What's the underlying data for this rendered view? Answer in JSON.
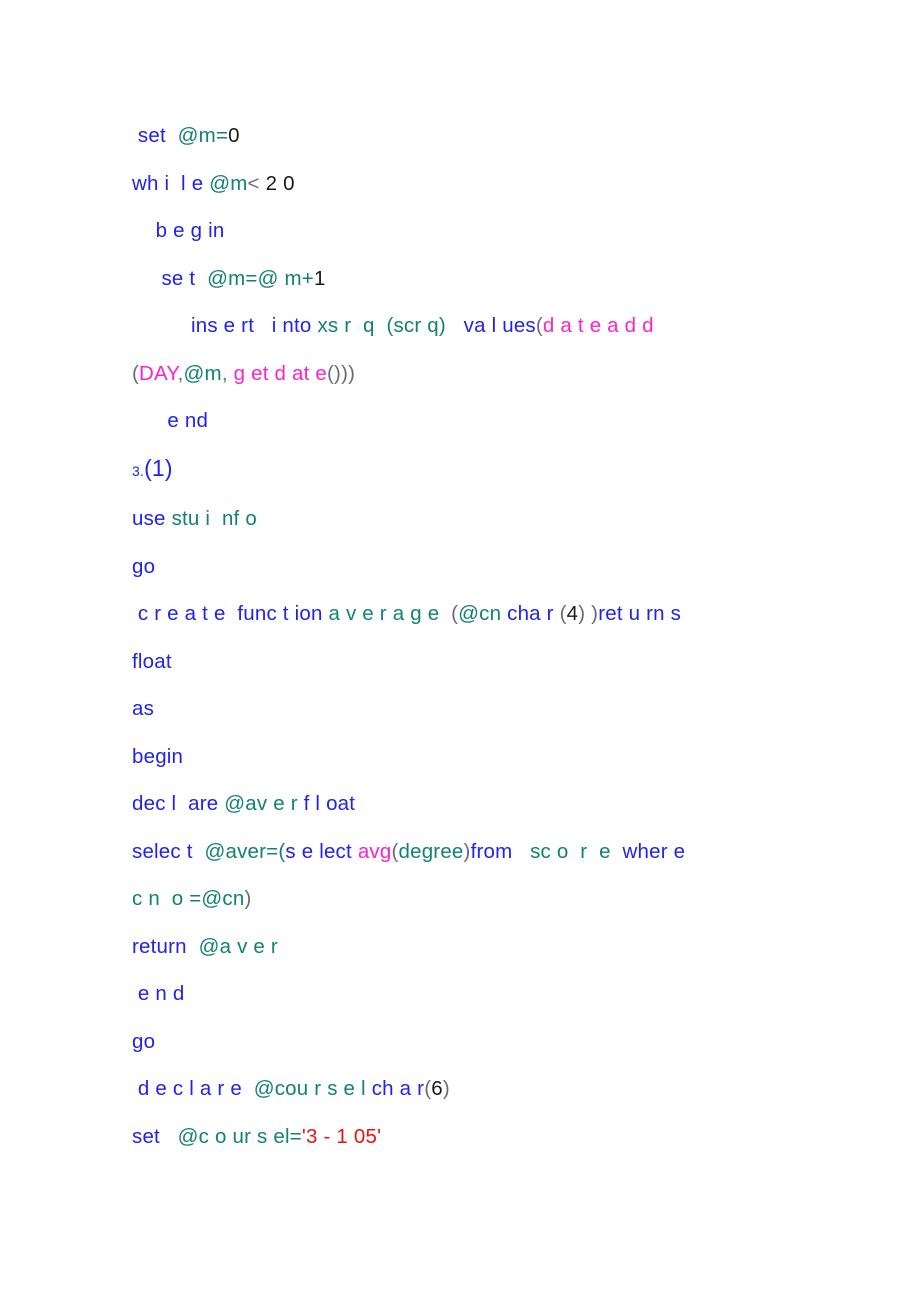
{
  "document": {
    "kind": "sql-code-listing",
    "background_color": "#ffffff",
    "colors": {
      "keyword": "#2222ee",
      "identifier": "#128273",
      "function": "#ff22cc",
      "number": "#1a1a1a",
      "string": "#ee1111",
      "punctuation": "#6b6b78"
    }
  },
  "lines": [
    {
      "id": "line-set-m-0",
      "indent": " ",
      "tokens": [
        {
          "t": "set",
          "c": "kw"
        },
        {
          "t": "  ",
          "c": "pun"
        },
        {
          "t": "@m",
          "c": "id"
        },
        {
          "t": "=",
          "c": "id"
        },
        {
          "t": "0",
          "c": "num"
        }
      ]
    },
    {
      "id": "line-while",
      "indent": "",
      "tokens": [
        {
          "t": "wh i  l e",
          "c": "kw"
        },
        {
          "t": " ",
          "c": "pun"
        },
        {
          "t": "@m",
          "c": "id"
        },
        {
          "t": "<",
          "c": "opg"
        },
        {
          "t": " 2 0",
          "c": "num"
        }
      ]
    },
    {
      "id": "line-begin-1",
      "indent": "    ",
      "tokens": [
        {
          "t": "b e g in",
          "c": "kw"
        }
      ]
    },
    {
      "id": "line-set-m-inc",
      "indent": "     ",
      "tokens": [
        {
          "t": "se t",
          "c": "kw"
        },
        {
          "t": "  ",
          "c": "pun"
        },
        {
          "t": "@m",
          "c": "id"
        },
        {
          "t": "=",
          "c": "id"
        },
        {
          "t": "@ m",
          "c": "id"
        },
        {
          "t": "+",
          "c": "id"
        },
        {
          "t": "1",
          "c": "num"
        }
      ]
    },
    {
      "id": "line-insert",
      "indent": "          ",
      "tokens": [
        {
          "t": "ins e rt",
          "c": "kw"
        },
        {
          "t": "   ",
          "c": "pun"
        },
        {
          "t": "i nto",
          "c": "kw"
        },
        {
          "t": " ",
          "c": "pun"
        },
        {
          "t": "xs r  q",
          "c": "id"
        },
        {
          "t": "  ",
          "c": "pun"
        },
        {
          "t": "(scr q)",
          "c": "id"
        },
        {
          "t": "   ",
          "c": "pun"
        },
        {
          "t": "va l ues",
          "c": "kw"
        },
        {
          "t": "(",
          "c": "pun"
        },
        {
          "t": "d a t e a d d",
          "c": "fn"
        }
      ]
    },
    {
      "id": "line-dateadd-args",
      "indent": "",
      "tokens": [
        {
          "t": "(",
          "c": "pun"
        },
        {
          "t": "DAY",
          "c": "fn"
        },
        {
          "t": ",",
          "c": "pun"
        },
        {
          "t": "@m",
          "c": "id"
        },
        {
          "t": ", ",
          "c": "pun"
        },
        {
          "t": "g et d at e",
          "c": "fn"
        },
        {
          "t": "()))",
          "c": "pun"
        }
      ]
    },
    {
      "id": "line-end-1",
      "indent": "      ",
      "tokens": [
        {
          "t": "e nd",
          "c": "kw"
        }
      ]
    },
    {
      "id": "line-heading-3-1",
      "indent": "",
      "tokens": [
        {
          "t": "3.",
          "c": "kw",
          "size": "small-num"
        },
        {
          "t": "(1)",
          "c": "kw",
          "size": "big"
        }
      ]
    },
    {
      "id": "line-use-stuinfo",
      "indent": "",
      "tokens": [
        {
          "t": "use",
          "c": "kw"
        },
        {
          "t": " ",
          "c": "pun"
        },
        {
          "t": "stu i  nf o",
          "c": "id"
        }
      ]
    },
    {
      "id": "line-go-1",
      "indent": "",
      "tokens": [
        {
          "t": "go",
          "c": "kw"
        }
      ]
    },
    {
      "id": "line-create-function",
      "indent": " ",
      "tokens": [
        {
          "t": "c r e a t e",
          "c": "kw"
        },
        {
          "t": "  ",
          "c": "pun"
        },
        {
          "t": "func t ion",
          "c": "kw"
        },
        {
          "t": " ",
          "c": "pun"
        },
        {
          "t": "a v e r a g e",
          "c": "id"
        },
        {
          "t": "  ",
          "c": "pun"
        },
        {
          "t": "(",
          "c": "pun"
        },
        {
          "t": "@cn",
          "c": "id"
        },
        {
          "t": " ",
          "c": "pun"
        },
        {
          "t": "cha r",
          "c": "kw"
        },
        {
          "t": " ",
          "c": "pun"
        },
        {
          "t": "(",
          "c": "pun"
        },
        {
          "t": "4",
          "c": "num"
        },
        {
          "t": ")",
          "c": "pun"
        },
        {
          "t": " )",
          "c": "pun"
        },
        {
          "t": "ret u rn s",
          "c": "kw"
        }
      ]
    },
    {
      "id": "line-float",
      "indent": "",
      "tokens": [
        {
          "t": "float",
          "c": "kw"
        }
      ]
    },
    {
      "id": "line-as",
      "indent": "",
      "tokens": [
        {
          "t": "as",
          "c": "kw"
        }
      ]
    },
    {
      "id": "line-begin-2",
      "indent": "",
      "tokens": [
        {
          "t": "begin",
          "c": "kw"
        }
      ]
    },
    {
      "id": "line-declare-aver",
      "indent": "",
      "tokens": [
        {
          "t": "dec l  are",
          "c": "kw"
        },
        {
          "t": " ",
          "c": "pun"
        },
        {
          "t": "@av e r",
          "c": "id"
        },
        {
          "t": " ",
          "c": "pun"
        },
        {
          "t": "f l oat",
          "c": "kw"
        }
      ]
    },
    {
      "id": "line-select-aver",
      "indent": "",
      "tokens": [
        {
          "t": "selec t",
          "c": "kw"
        },
        {
          "t": "  ",
          "c": "pun"
        },
        {
          "t": "@aver",
          "c": "id"
        },
        {
          "t": "=",
          "c": "id"
        },
        {
          "t": "(",
          "c": "id"
        },
        {
          "t": "s e lect",
          "c": "kw"
        },
        {
          "t": " ",
          "c": "pun"
        },
        {
          "t": "avg",
          "c": "fn"
        },
        {
          "t": "(",
          "c": "pun"
        },
        {
          "t": "degree",
          "c": "id"
        },
        {
          "t": ")",
          "c": "pun"
        },
        {
          "t": "from",
          "c": "kw"
        },
        {
          "t": "   ",
          "c": "pun"
        },
        {
          "t": "sc o  r  e",
          "c": "id"
        },
        {
          "t": "  ",
          "c": "pun"
        },
        {
          "t": "wher e",
          "c": "kw"
        }
      ]
    },
    {
      "id": "line-cno-eq",
      "indent": "",
      "tokens": [
        {
          "t": "c n  o",
          "c": "id"
        },
        {
          "t": " =",
          "c": "id"
        },
        {
          "t": "@cn",
          "c": "id"
        },
        {
          "t": ")",
          "c": "pun"
        }
      ]
    },
    {
      "id": "line-return-aver",
      "indent": "",
      "tokens": [
        {
          "t": "return",
          "c": "kw"
        },
        {
          "t": "  ",
          "c": "pun"
        },
        {
          "t": "@a v e r",
          "c": "id"
        }
      ]
    },
    {
      "id": "line-end-2",
      "indent": " ",
      "tokens": [
        {
          "t": "e n d",
          "c": "kw"
        }
      ]
    },
    {
      "id": "line-go-2",
      "indent": "",
      "tokens": [
        {
          "t": "go",
          "c": "kw"
        }
      ]
    },
    {
      "id": "line-declare-coursel",
      "indent": " ",
      "tokens": [
        {
          "t": "d e c l a r e",
          "c": "kw"
        },
        {
          "t": "  ",
          "c": "pun"
        },
        {
          "t": "@cou r s e l",
          "c": "id"
        },
        {
          "t": " ",
          "c": "pun"
        },
        {
          "t": "ch a r",
          "c": "kw"
        },
        {
          "t": "(",
          "c": "pun"
        },
        {
          "t": "6",
          "c": "num"
        },
        {
          "t": ")",
          "c": "pun"
        }
      ]
    },
    {
      "id": "line-set-coursel",
      "indent": "",
      "tokens": [
        {
          "t": "set",
          "c": "kw"
        },
        {
          "t": "   ",
          "c": "pun"
        },
        {
          "t": "@c o ur s el",
          "c": "id"
        },
        {
          "t": "=",
          "c": "id"
        },
        {
          "t": "'3 - 1 05'",
          "c": "str"
        }
      ]
    }
  ]
}
